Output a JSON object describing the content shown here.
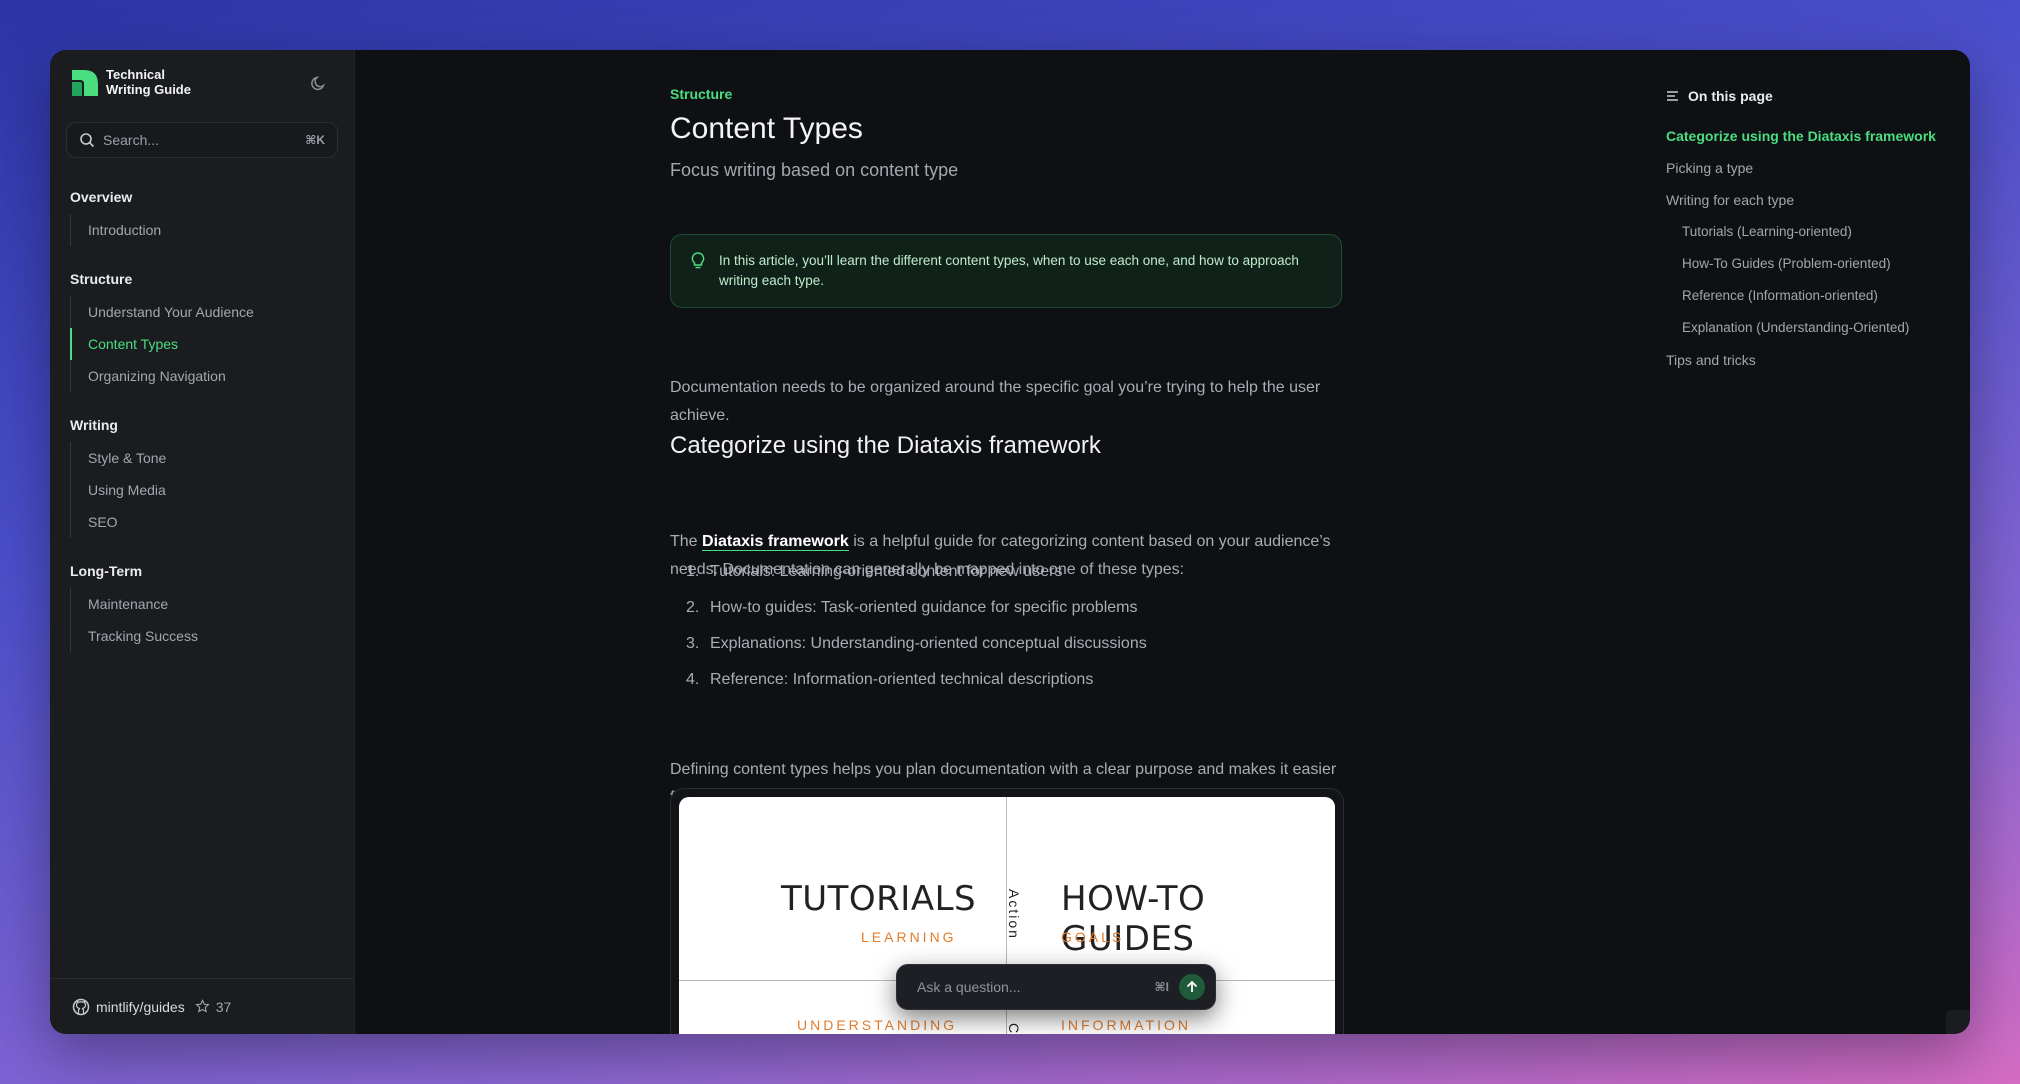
{
  "brand": {
    "line1": "Technical",
    "line2": "Writing Guide"
  },
  "search": {
    "placeholder": "Search...",
    "shortcut": "⌘K"
  },
  "nav": [
    {
      "title": "Overview",
      "items": [
        {
          "label": "Introduction"
        }
      ]
    },
    {
      "title": "Structure",
      "items": [
        {
          "label": "Understand Your Audience"
        },
        {
          "label": "Content Types",
          "active": true
        },
        {
          "label": "Organizing Navigation"
        }
      ]
    },
    {
      "title": "Writing",
      "items": [
        {
          "label": "Style & Tone"
        },
        {
          "label": "Using Media"
        },
        {
          "label": "SEO"
        }
      ]
    },
    {
      "title": "Long-Term",
      "items": [
        {
          "label": "Maintenance"
        },
        {
          "label": "Tracking Success"
        }
      ]
    }
  ],
  "footer": {
    "repo": "mintlify/guides",
    "stars": "37"
  },
  "page": {
    "eyebrow": "Structure",
    "title": "Content Types",
    "subtitle": "Focus writing based on content type",
    "callout": "In this article, you’ll learn the different content types, when to use each one, and how to approach writing each type.",
    "intro": "Documentation needs to be organized around the specific goal you’re trying to help the user achieve.",
    "section_heading": "Categorize using the Diataxis framework",
    "para1_prefix": "The ",
    "para1_link": "Diataxis framework",
    "para1_suffix": " is a helpful guide for categorizing content based on your audience’s needs. Documentation can generally be mapped into one of these types:",
    "list": [
      {
        "num": "1.",
        "text": "Tutorials: Learning-oriented content for new users"
      },
      {
        "num": "2.",
        "text": "How-to guides: Task-oriented guidance for specific problems"
      },
      {
        "num": "3.",
        "text": "Explanations: Understanding-oriented conceptual discussions"
      },
      {
        "num": "4.",
        "text": "Reference: Information-oriented technical descriptions"
      }
    ],
    "para2": "Defining content types helps you plan documentation with a clear purpose and makes it easier for users to find what they need.",
    "figure": {
      "tl_title": "TUTORIALS",
      "tl_sub": "LEARNING",
      "tr_title": "HOW-TO GUIDES",
      "tr_sub": "GOALS",
      "bl_sub": "UNDERSTANDING",
      "br_sub": "INFORMATION",
      "axis_top": "Action",
      "axis_bottom": "Co"
    }
  },
  "ask": {
    "placeholder": "Ask a question...",
    "shortcut": "⌘I"
  },
  "toc": {
    "heading": "On this page",
    "items": [
      {
        "label": "Categorize using the Diataxis framework",
        "active": true
      },
      {
        "label": "Picking a type"
      },
      {
        "label": "Writing for each type"
      },
      {
        "label": "Tutorials (Learning-oriented)",
        "sub": true
      },
      {
        "label": "How-To Guides (Problem-oriented)",
        "sub": true
      },
      {
        "label": "Reference (Information-oriented)",
        "sub": true
      },
      {
        "label": "Explanation (Understanding-Oriented)",
        "sub": true
      },
      {
        "label": "Tips and tricks"
      }
    ]
  },
  "colors": {
    "accent": "#4ade80",
    "background": "#0f1013",
    "sidebar": "#1b1c20"
  }
}
